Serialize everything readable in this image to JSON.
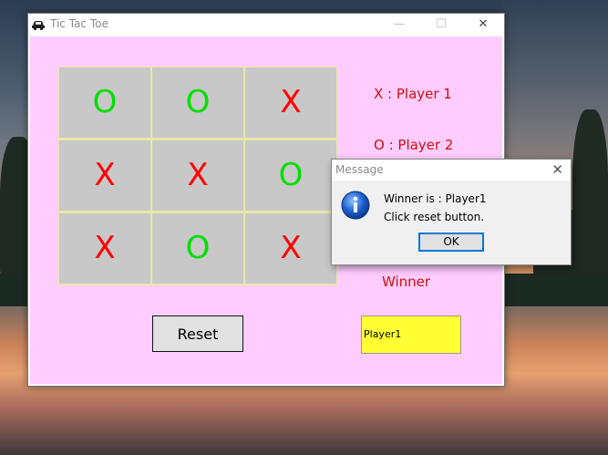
{
  "window": {
    "title": "Tic Tac Toe",
    "minimize_glyph": "—",
    "maximize_glyph": "☐",
    "close_glyph": "✕"
  },
  "board": {
    "cells": [
      "O",
      "O",
      "X",
      "X",
      "X",
      "O",
      "X",
      "O",
      "X"
    ]
  },
  "legend": {
    "player1": "X :  Player 1",
    "player2": "O :  Player 2",
    "winner_label": "Winner"
  },
  "controls": {
    "reset_label": "Reset",
    "winner_value": "Player1"
  },
  "dialog": {
    "title": "Message",
    "close_glyph": "✕",
    "line1": "Winner is : Player1",
    "line2": "Click reset button.",
    "ok_label": "OK"
  },
  "colors": {
    "x_mark": "#ff0000",
    "o_mark": "#00e000",
    "client_background": "#ffccff",
    "winner_box": "#ffff33",
    "legend_text": "#cc1111"
  },
  "icons": {
    "app": "car-icon",
    "dialog": "information-icon"
  }
}
